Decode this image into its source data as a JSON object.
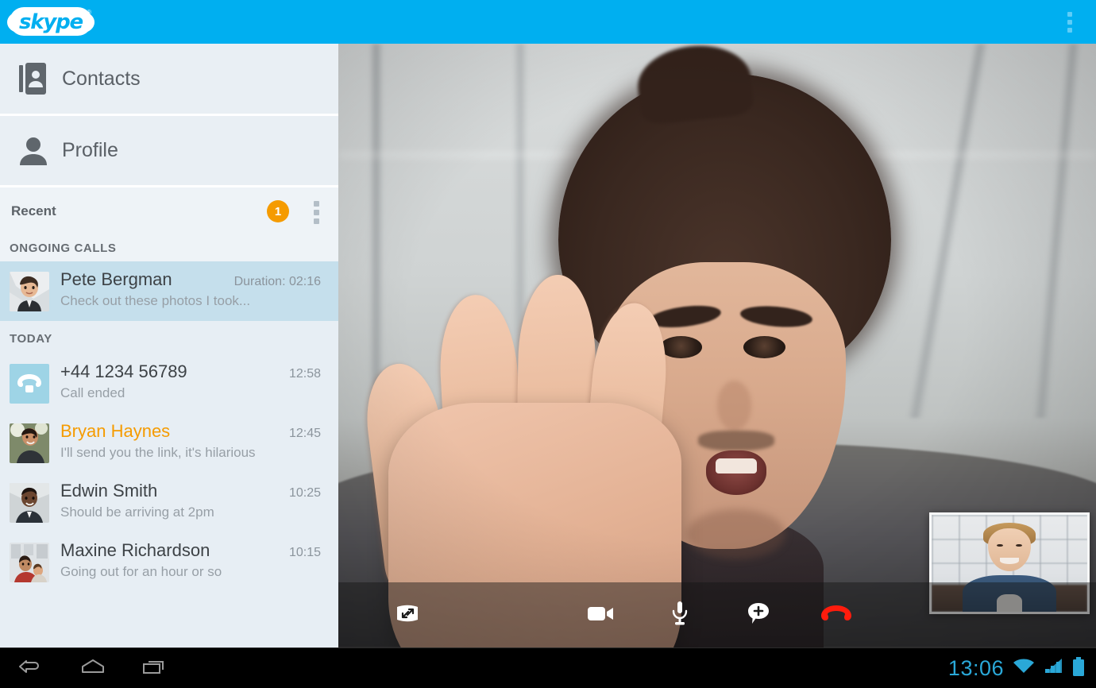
{
  "app": {
    "name": "Skype",
    "logo_text": "skype",
    "logo_tm": "®",
    "brand_color": "#00AFF0",
    "overflow_icon": "overflow-menu-icon"
  },
  "sidebar": {
    "nav": [
      {
        "label": "Contacts",
        "icon": "contacts-book-icon"
      },
      {
        "label": "Profile",
        "icon": "person-icon"
      }
    ],
    "recent": {
      "title": "Recent",
      "badge_count": "1",
      "badge_color": "#F59B00",
      "overflow_icon": "overflow-menu-icon"
    },
    "sections": [
      {
        "label": "ONGOING CALLS",
        "items": [
          {
            "name": "Pete Bergman",
            "meta": "Duration: 02:16",
            "preview": "Check out these photos I took...",
            "avatar": "photo-avatar-pete",
            "active": true,
            "name_color": "default"
          }
        ]
      },
      {
        "label": "TODAY",
        "items": [
          {
            "name": "+44 1234 56789",
            "meta": "12:58",
            "preview": "Call ended",
            "avatar": "phone-handset-icon",
            "active": false,
            "name_color": "default"
          },
          {
            "name": "Bryan Haynes",
            "meta": "12:45",
            "preview": "I'll send you the link, it's hilarious",
            "avatar": "photo-avatar-bryan",
            "active": false,
            "name_color": "#F59B00"
          },
          {
            "name": "Edwin Smith",
            "meta": "10:25",
            "preview": "Should be arriving at 2pm",
            "avatar": "photo-avatar-edwin",
            "active": false,
            "name_color": "default"
          },
          {
            "name": "Maxine Richardson",
            "meta": "10:15",
            "preview": "Going out for an hour or so",
            "avatar": "photo-avatar-maxine",
            "active": false,
            "name_color": "default"
          }
        ]
      }
    ]
  },
  "call": {
    "remote_video_alt": "Pete Bergman video — man holding palm toward camera",
    "self_view_alt": "Self view — smiling man in blue shirt",
    "controls": [
      {
        "label": "Fullscreen",
        "icon": "expand-icon"
      },
      {
        "label": "Video",
        "icon": "video-camera-icon"
      },
      {
        "label": "Mute",
        "icon": "microphone-icon"
      },
      {
        "label": "Add",
        "icon": "add-bubble-icon"
      },
      {
        "label": "End call",
        "icon": "end-call-icon",
        "color": "#FF1C0D"
      }
    ]
  },
  "system": {
    "nav": [
      {
        "label": "Back",
        "icon": "back-arrow-icon"
      },
      {
        "label": "Home",
        "icon": "home-icon"
      },
      {
        "label": "Recents",
        "icon": "recents-icon"
      }
    ],
    "clock": "13:06",
    "indicators": [
      {
        "icon": "wifi-icon"
      },
      {
        "icon": "cellular-signal-icon"
      },
      {
        "icon": "battery-icon"
      }
    ],
    "accent_color": "#2aa8d8"
  }
}
